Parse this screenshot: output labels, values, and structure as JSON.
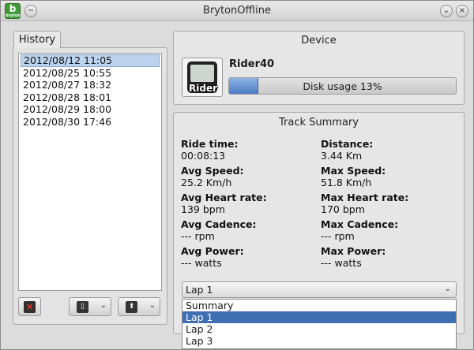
{
  "window": {
    "title": "BrytonOffline",
    "app_icon_letter": "b",
    "app_icon_tag": "bryton",
    "menu_glyph": "−",
    "minimize_glyph": "⌄",
    "close_glyph": "×"
  },
  "history": {
    "tab_label": "History",
    "items": [
      {
        "label": "2012/08/12 11:05",
        "selected": true
      },
      {
        "label": "2012/08/25 10:55",
        "selected": false
      },
      {
        "label": "2012/08/27 18:32",
        "selected": false
      },
      {
        "label": "2012/08/28 18:01",
        "selected": false
      },
      {
        "label": "2012/08/29 18:00",
        "selected": false
      },
      {
        "label": "2012/08/30 17:46",
        "selected": false
      }
    ],
    "buttons": {
      "delete_icon": "×",
      "export_icon": "▯",
      "upload_icon": "⬆",
      "chevron": "⌄"
    }
  },
  "device": {
    "panel_title": "Device",
    "image_label": "Rider",
    "name": "Rider40",
    "disk_usage_text": "Disk usage 13%",
    "disk_usage_fraction": 0.13
  },
  "track_summary": {
    "panel_title": "Track Summary",
    "stats": {
      "ride_time_label": "Ride time:",
      "ride_time_value": "00:08:13",
      "distance_label": "Distance:",
      "distance_value": "3.44 Km",
      "avg_speed_label": "Avg Speed:",
      "avg_speed_value": "25.2 Km/h",
      "max_speed_label": "Max Speed:",
      "max_speed_value": "51.8 Km/h",
      "avg_hr_label": "Avg Heart rate:",
      "avg_hr_value": "139 bpm",
      "max_hr_label": "Max Heart rate:",
      "max_hr_value": "170 bpm",
      "avg_cadence_label": "Avg Cadence:",
      "avg_cadence_value": "--- rpm",
      "max_cadence_label": "Max Cadence:",
      "max_cadence_value": "--- rpm",
      "avg_power_label": "Avg Power:",
      "avg_power_value": "--- watts",
      "max_power_label": "Max Power:",
      "max_power_value": "--- watts"
    },
    "lap_select": {
      "value": "Lap 1",
      "chevron": "⌄",
      "options": [
        {
          "label": "Summary",
          "selected": false
        },
        {
          "label": "Lap 1",
          "selected": true
        },
        {
          "label": "Lap 2",
          "selected": false
        },
        {
          "label": "Lap 3",
          "selected": false
        }
      ]
    }
  }
}
